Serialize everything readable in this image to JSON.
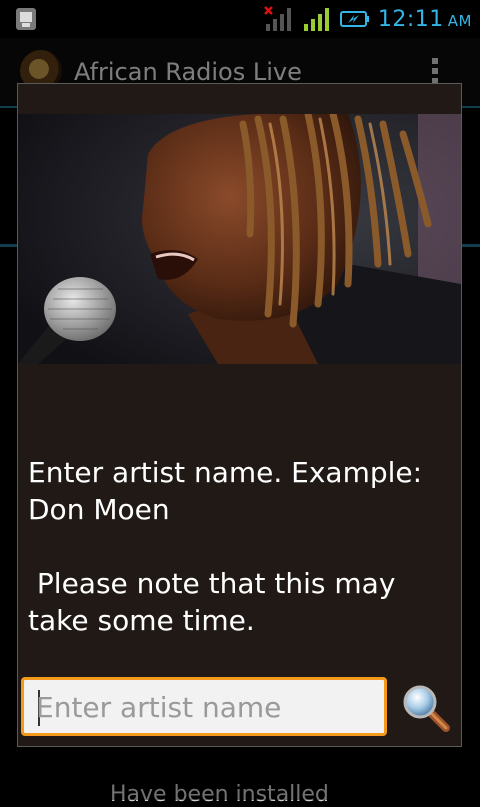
{
  "status_bar": {
    "time": "12:11",
    "ampm": "AM",
    "time_color": "#33b5e5",
    "icons": [
      "android-debug-icon",
      "no-signal-icon",
      "signal-icon",
      "battery-charging-icon"
    ]
  },
  "app": {
    "title": "African Radios Live",
    "bottom_text": "Have  been installed"
  },
  "dialog": {
    "photo": "singer-photo",
    "message": "Enter artist name. Example: Don Moen\n\n Please note that this may take some time.",
    "input": {
      "value": "",
      "placeholder": "Enter artist name"
    },
    "search_icon": "search-icon"
  },
  "colors": {
    "accent": "#f39a1c",
    "dialog_bg": "#201915",
    "blue": "#1f6f8b"
  }
}
